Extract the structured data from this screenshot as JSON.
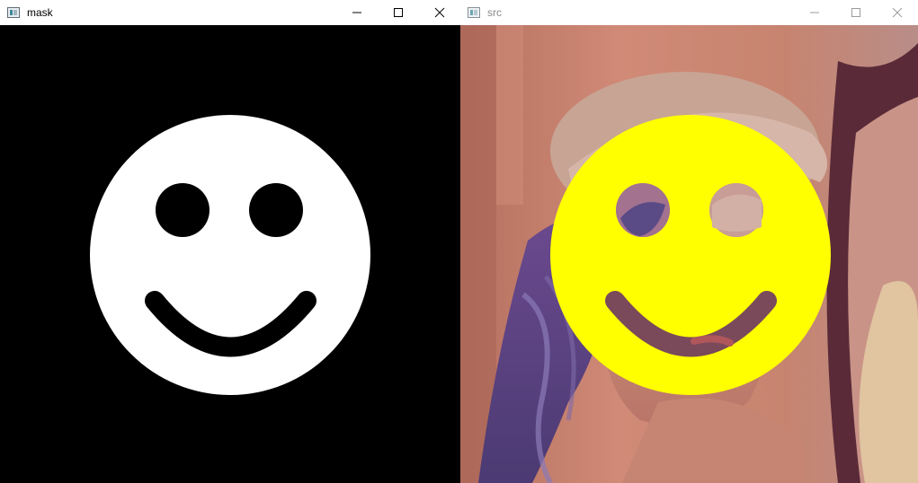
{
  "windows": [
    {
      "title": "mask",
      "controls": {
        "minimize": "minimize-icon",
        "maximize": "maximize-icon",
        "close": "close-icon"
      },
      "colors": {
        "background": "#000000",
        "shape": "#ffffff"
      }
    },
    {
      "title": "src",
      "controls": {
        "minimize": "minimize-icon",
        "maximize": "maximize-icon",
        "close": "close-icon"
      },
      "colors": {
        "overlay": "#ffff00"
      }
    }
  ]
}
